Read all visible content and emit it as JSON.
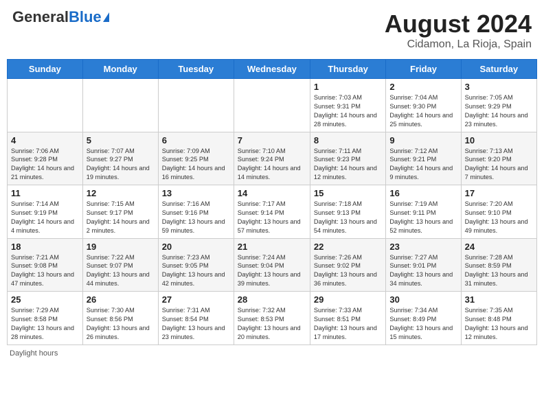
{
  "header": {
    "logo_general": "General",
    "logo_blue": "Blue",
    "title": "August 2024",
    "subtitle": "Cidamon, La Rioja, Spain"
  },
  "days_of_week": [
    "Sunday",
    "Monday",
    "Tuesday",
    "Wednesday",
    "Thursday",
    "Friday",
    "Saturday"
  ],
  "weeks": [
    [
      {
        "day": "",
        "info": ""
      },
      {
        "day": "",
        "info": ""
      },
      {
        "day": "",
        "info": ""
      },
      {
        "day": "",
        "info": ""
      },
      {
        "day": "1",
        "info": "Sunrise: 7:03 AM\nSunset: 9:31 PM\nDaylight: 14 hours\nand 28 minutes."
      },
      {
        "day": "2",
        "info": "Sunrise: 7:04 AM\nSunset: 9:30 PM\nDaylight: 14 hours\nand 25 minutes."
      },
      {
        "day": "3",
        "info": "Sunrise: 7:05 AM\nSunset: 9:29 PM\nDaylight: 14 hours\nand 23 minutes."
      }
    ],
    [
      {
        "day": "4",
        "info": "Sunrise: 7:06 AM\nSunset: 9:28 PM\nDaylight: 14 hours\nand 21 minutes."
      },
      {
        "day": "5",
        "info": "Sunrise: 7:07 AM\nSunset: 9:27 PM\nDaylight: 14 hours\nand 19 minutes."
      },
      {
        "day": "6",
        "info": "Sunrise: 7:09 AM\nSunset: 9:25 PM\nDaylight: 14 hours\nand 16 minutes."
      },
      {
        "day": "7",
        "info": "Sunrise: 7:10 AM\nSunset: 9:24 PM\nDaylight: 14 hours\nand 14 minutes."
      },
      {
        "day": "8",
        "info": "Sunrise: 7:11 AM\nSunset: 9:23 PM\nDaylight: 14 hours\nand 12 minutes."
      },
      {
        "day": "9",
        "info": "Sunrise: 7:12 AM\nSunset: 9:21 PM\nDaylight: 14 hours\nand 9 minutes."
      },
      {
        "day": "10",
        "info": "Sunrise: 7:13 AM\nSunset: 9:20 PM\nDaylight: 14 hours\nand 7 minutes."
      }
    ],
    [
      {
        "day": "11",
        "info": "Sunrise: 7:14 AM\nSunset: 9:19 PM\nDaylight: 14 hours\nand 4 minutes."
      },
      {
        "day": "12",
        "info": "Sunrise: 7:15 AM\nSunset: 9:17 PM\nDaylight: 14 hours\nand 2 minutes."
      },
      {
        "day": "13",
        "info": "Sunrise: 7:16 AM\nSunset: 9:16 PM\nDaylight: 13 hours\nand 59 minutes."
      },
      {
        "day": "14",
        "info": "Sunrise: 7:17 AM\nSunset: 9:14 PM\nDaylight: 13 hours\nand 57 minutes."
      },
      {
        "day": "15",
        "info": "Sunrise: 7:18 AM\nSunset: 9:13 PM\nDaylight: 13 hours\nand 54 minutes."
      },
      {
        "day": "16",
        "info": "Sunrise: 7:19 AM\nSunset: 9:11 PM\nDaylight: 13 hours\nand 52 minutes."
      },
      {
        "day": "17",
        "info": "Sunrise: 7:20 AM\nSunset: 9:10 PM\nDaylight: 13 hours\nand 49 minutes."
      }
    ],
    [
      {
        "day": "18",
        "info": "Sunrise: 7:21 AM\nSunset: 9:08 PM\nDaylight: 13 hours\nand 47 minutes."
      },
      {
        "day": "19",
        "info": "Sunrise: 7:22 AM\nSunset: 9:07 PM\nDaylight: 13 hours\nand 44 minutes."
      },
      {
        "day": "20",
        "info": "Sunrise: 7:23 AM\nSunset: 9:05 PM\nDaylight: 13 hours\nand 42 minutes."
      },
      {
        "day": "21",
        "info": "Sunrise: 7:24 AM\nSunset: 9:04 PM\nDaylight: 13 hours\nand 39 minutes."
      },
      {
        "day": "22",
        "info": "Sunrise: 7:26 AM\nSunset: 9:02 PM\nDaylight: 13 hours\nand 36 minutes."
      },
      {
        "day": "23",
        "info": "Sunrise: 7:27 AM\nSunset: 9:01 PM\nDaylight: 13 hours\nand 34 minutes."
      },
      {
        "day": "24",
        "info": "Sunrise: 7:28 AM\nSunset: 8:59 PM\nDaylight: 13 hours\nand 31 minutes."
      }
    ],
    [
      {
        "day": "25",
        "info": "Sunrise: 7:29 AM\nSunset: 8:58 PM\nDaylight: 13 hours\nand 28 minutes."
      },
      {
        "day": "26",
        "info": "Sunrise: 7:30 AM\nSunset: 8:56 PM\nDaylight: 13 hours\nand 26 minutes."
      },
      {
        "day": "27",
        "info": "Sunrise: 7:31 AM\nSunset: 8:54 PM\nDaylight: 13 hours\nand 23 minutes."
      },
      {
        "day": "28",
        "info": "Sunrise: 7:32 AM\nSunset: 8:53 PM\nDaylight: 13 hours\nand 20 minutes."
      },
      {
        "day": "29",
        "info": "Sunrise: 7:33 AM\nSunset: 8:51 PM\nDaylight: 13 hours\nand 17 minutes."
      },
      {
        "day": "30",
        "info": "Sunrise: 7:34 AM\nSunset: 8:49 PM\nDaylight: 13 hours\nand 15 minutes."
      },
      {
        "day": "31",
        "info": "Sunrise: 7:35 AM\nSunset: 8:48 PM\nDaylight: 13 hours\nand 12 minutes."
      }
    ]
  ],
  "footer": "Daylight hours"
}
